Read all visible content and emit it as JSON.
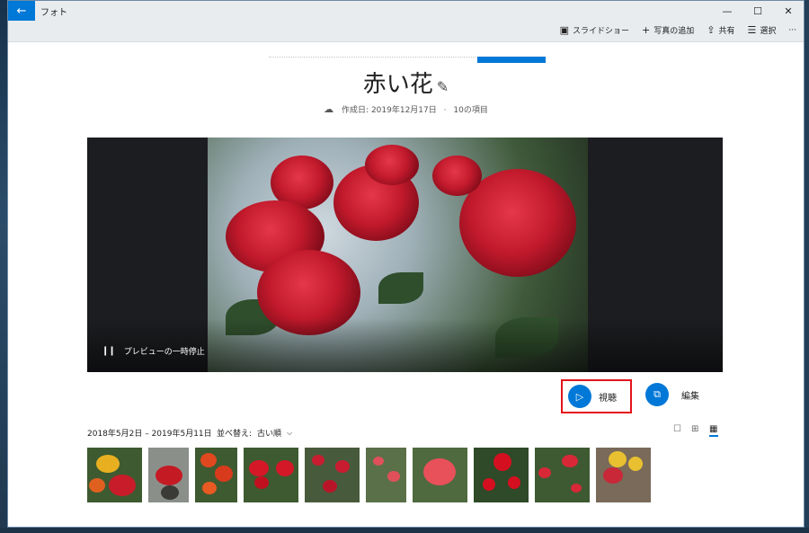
{
  "window": {
    "app_title": "フォト",
    "back_icon": "back-arrow-icon"
  },
  "window_controls": {
    "minimize": "—",
    "maximize": "☐",
    "close": "✕"
  },
  "toolbar": {
    "slideshow_label": "スライドショー",
    "add_photos_label": "写真の追加",
    "share_label": "共有",
    "select_label": "選択",
    "more_label": "···"
  },
  "album": {
    "title": "赤い花",
    "created": "作成日: 2019年12月17日",
    "separator": "·",
    "item_count": "10の項目"
  },
  "preview": {
    "pause_label": "プレビューの一時停止"
  },
  "actions": {
    "watch_label": "視聴",
    "edit_label": "編集"
  },
  "gallery": {
    "date_range": "2018年5月2日 – 2019年5月11日",
    "sort_label": "並べ替え:",
    "sort_value": "古い順",
    "thumbnail_count": 10
  },
  "colors": {
    "accent": "#0078d7",
    "highlight_border": "#e4141b"
  }
}
